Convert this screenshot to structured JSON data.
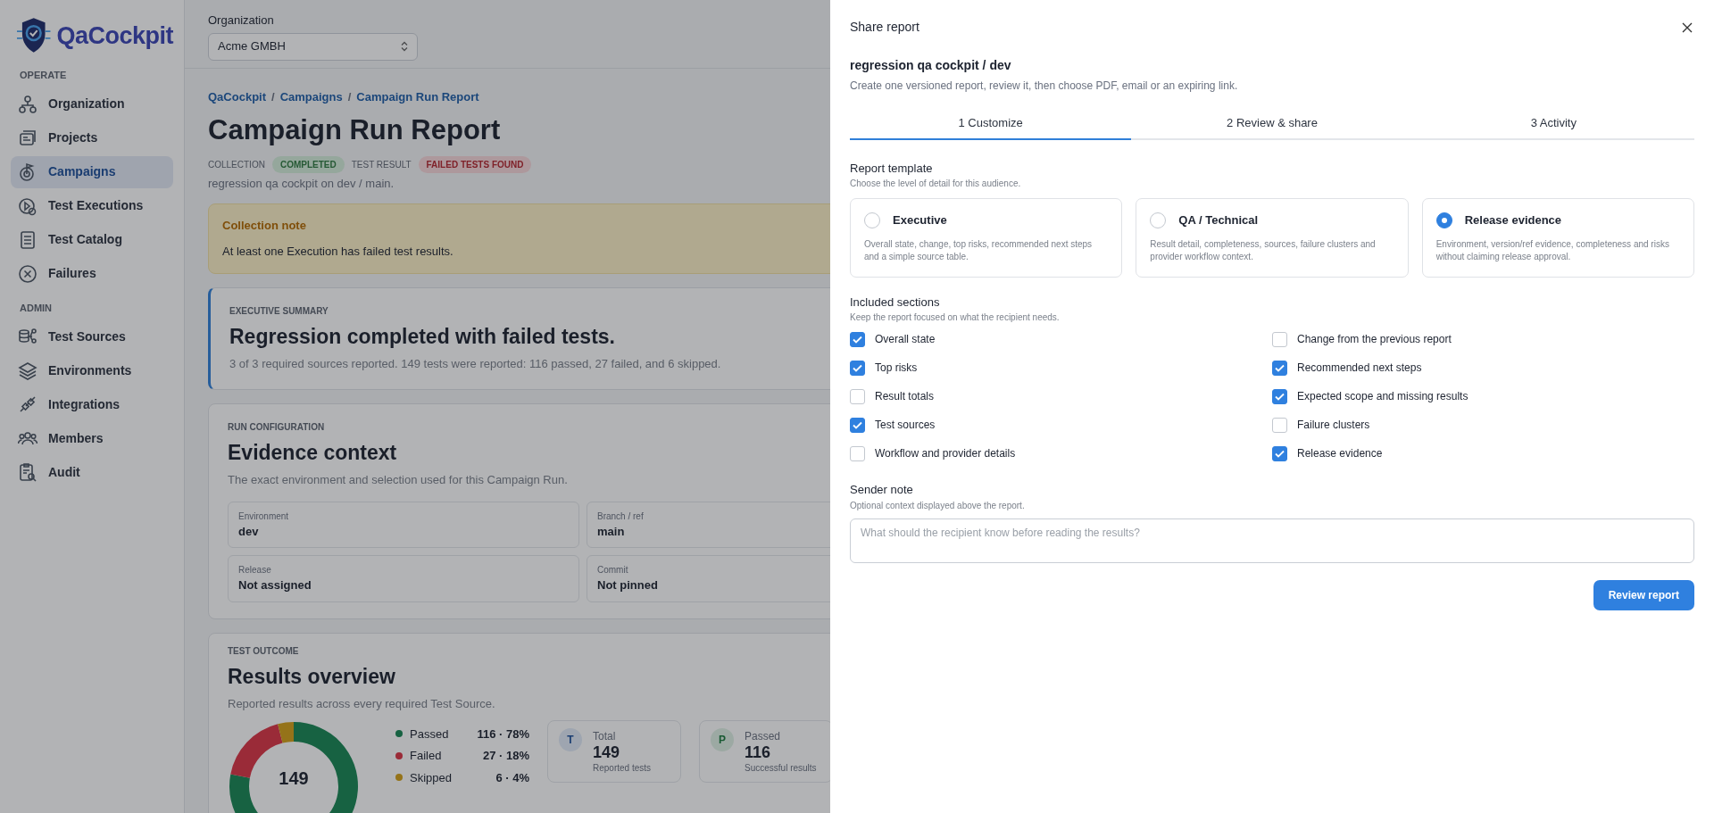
{
  "sidebar": {
    "logo_text": "QaCockpit",
    "sections": [
      {
        "heading": "OPERATE",
        "items": [
          {
            "label": "Organization",
            "selected": false
          },
          {
            "label": "Projects",
            "selected": false
          },
          {
            "label": "Campaigns",
            "selected": true
          },
          {
            "label": "Test Executions",
            "selected": false
          },
          {
            "label": "Test Catalog",
            "selected": false
          },
          {
            "label": "Failures",
            "selected": false
          }
        ]
      },
      {
        "heading": "ADMIN",
        "items": [
          {
            "label": "Test Sources",
            "selected": false
          },
          {
            "label": "Environments",
            "selected": false
          },
          {
            "label": "Integrations",
            "selected": false
          },
          {
            "label": "Members",
            "selected": false
          },
          {
            "label": "Audit",
            "selected": false
          }
        ]
      }
    ]
  },
  "topbar": {
    "org_label": "Organization",
    "org_value": "Acme GMBH"
  },
  "page": {
    "breadcrumb": [
      "QaCockpit",
      "Campaigns",
      "Campaign Run Report"
    ],
    "breadcrumb_separator": "/",
    "title": "Campaign Run Report",
    "status": [
      {
        "text": "COLLECTION",
        "kind": "label"
      },
      {
        "text": "COMPLETED",
        "kind": "success"
      },
      {
        "text": "TEST RESULT",
        "kind": "label"
      },
      {
        "text": "FAILED TESTS FOUND",
        "kind": "danger"
      }
    ],
    "subtitle": "regression qa cockpit on dev / main."
  },
  "alert": {
    "title": "Collection note",
    "text": "At least one Execution has failed test results."
  },
  "summary": {
    "eyebrow": "EXECUTIVE SUMMARY",
    "title": "Regression completed with failed tests.",
    "text": "3 of 3 required sources reported. 149 tests were reported: 116 passed, 27 failed, and 6 skipped."
  },
  "evidence": {
    "eyebrow": "RUN CONFIGURATION",
    "title": "Evidence context",
    "text": "The exact environment and selection used for this Campaign Run.",
    "fields": [
      {
        "label": "Environment",
        "value": "dev"
      },
      {
        "label": "Branch / ref",
        "value": "main"
      },
      {
        "label": "Release",
        "value": "Not assigned"
      },
      {
        "label": "Commit",
        "value": "Not pinned"
      }
    ]
  },
  "outcome": {
    "eyebrow": "TEST OUTCOME",
    "title": "Results overview",
    "text": "Reported results across every required Test Source.",
    "chart_data": {
      "type": "donut",
      "categories": [
        "Passed",
        "Failed",
        "Skipped"
      ],
      "values": [
        78,
        18,
        4
      ]
    },
    "center_value": "149",
    "legend": [
      "116 · 78%",
      "27 · 18%",
      "6 · 4%"
    ],
    "stats": [
      {
        "letter": "T",
        "label": "Total",
        "value": "149",
        "caption": "Reported tests",
        "kind": "total"
      },
      {
        "letter": "P",
        "label": "Passed",
        "value": "116",
        "caption": "Successful results",
        "kind": "passed"
      }
    ]
  },
  "drawer": {
    "title": "Share report",
    "subject": "regression qa cockpit / dev",
    "description": "Create one versioned report, review it, then choose PDF, email or an expiring link.",
    "tabs": [
      {
        "label": "1 Customize",
        "selected": true
      },
      {
        "label": "2 Review & share",
        "selected": false
      },
      {
        "label": "3 Activity",
        "selected": false
      }
    ],
    "template": {
      "heading": "Report template",
      "description": "Choose the level of detail for this audience.",
      "options": [
        {
          "title": "Executive",
          "text": "Overall state, change, top risks, recommended next steps and a simple source table.",
          "selected": false
        },
        {
          "title": "QA / Technical",
          "text": "Result detail, completeness, sources, failure clusters and provider workflow context.",
          "selected": false
        },
        {
          "title": "Release evidence",
          "text": "Environment, version/ref evidence, completeness and risks without claiming release approval.",
          "selected": true
        }
      ]
    },
    "sections": {
      "heading": "Included sections",
      "description": "Keep the report focused on what the recipient needs.",
      "items": [
        {
          "label": "Overall state",
          "checked": true
        },
        {
          "label": "Change from the previous report",
          "checked": false
        },
        {
          "label": "Top risks",
          "checked": true
        },
        {
          "label": "Recommended next steps",
          "checked": true
        },
        {
          "label": "Result totals",
          "checked": false
        },
        {
          "label": "Expected scope and missing results",
          "checked": true
        },
        {
          "label": "Test sources",
          "checked": true
        },
        {
          "label": "Failure clusters",
          "checked": false
        },
        {
          "label": "Workflow and provider details",
          "checked": false
        },
        {
          "label": "Release evidence",
          "checked": true
        }
      ]
    },
    "note": {
      "heading": "Sender note",
      "description": "Optional context displayed above the report.",
      "placeholder": "What should the recipient know before reading the results?"
    },
    "submit": "Review report"
  }
}
